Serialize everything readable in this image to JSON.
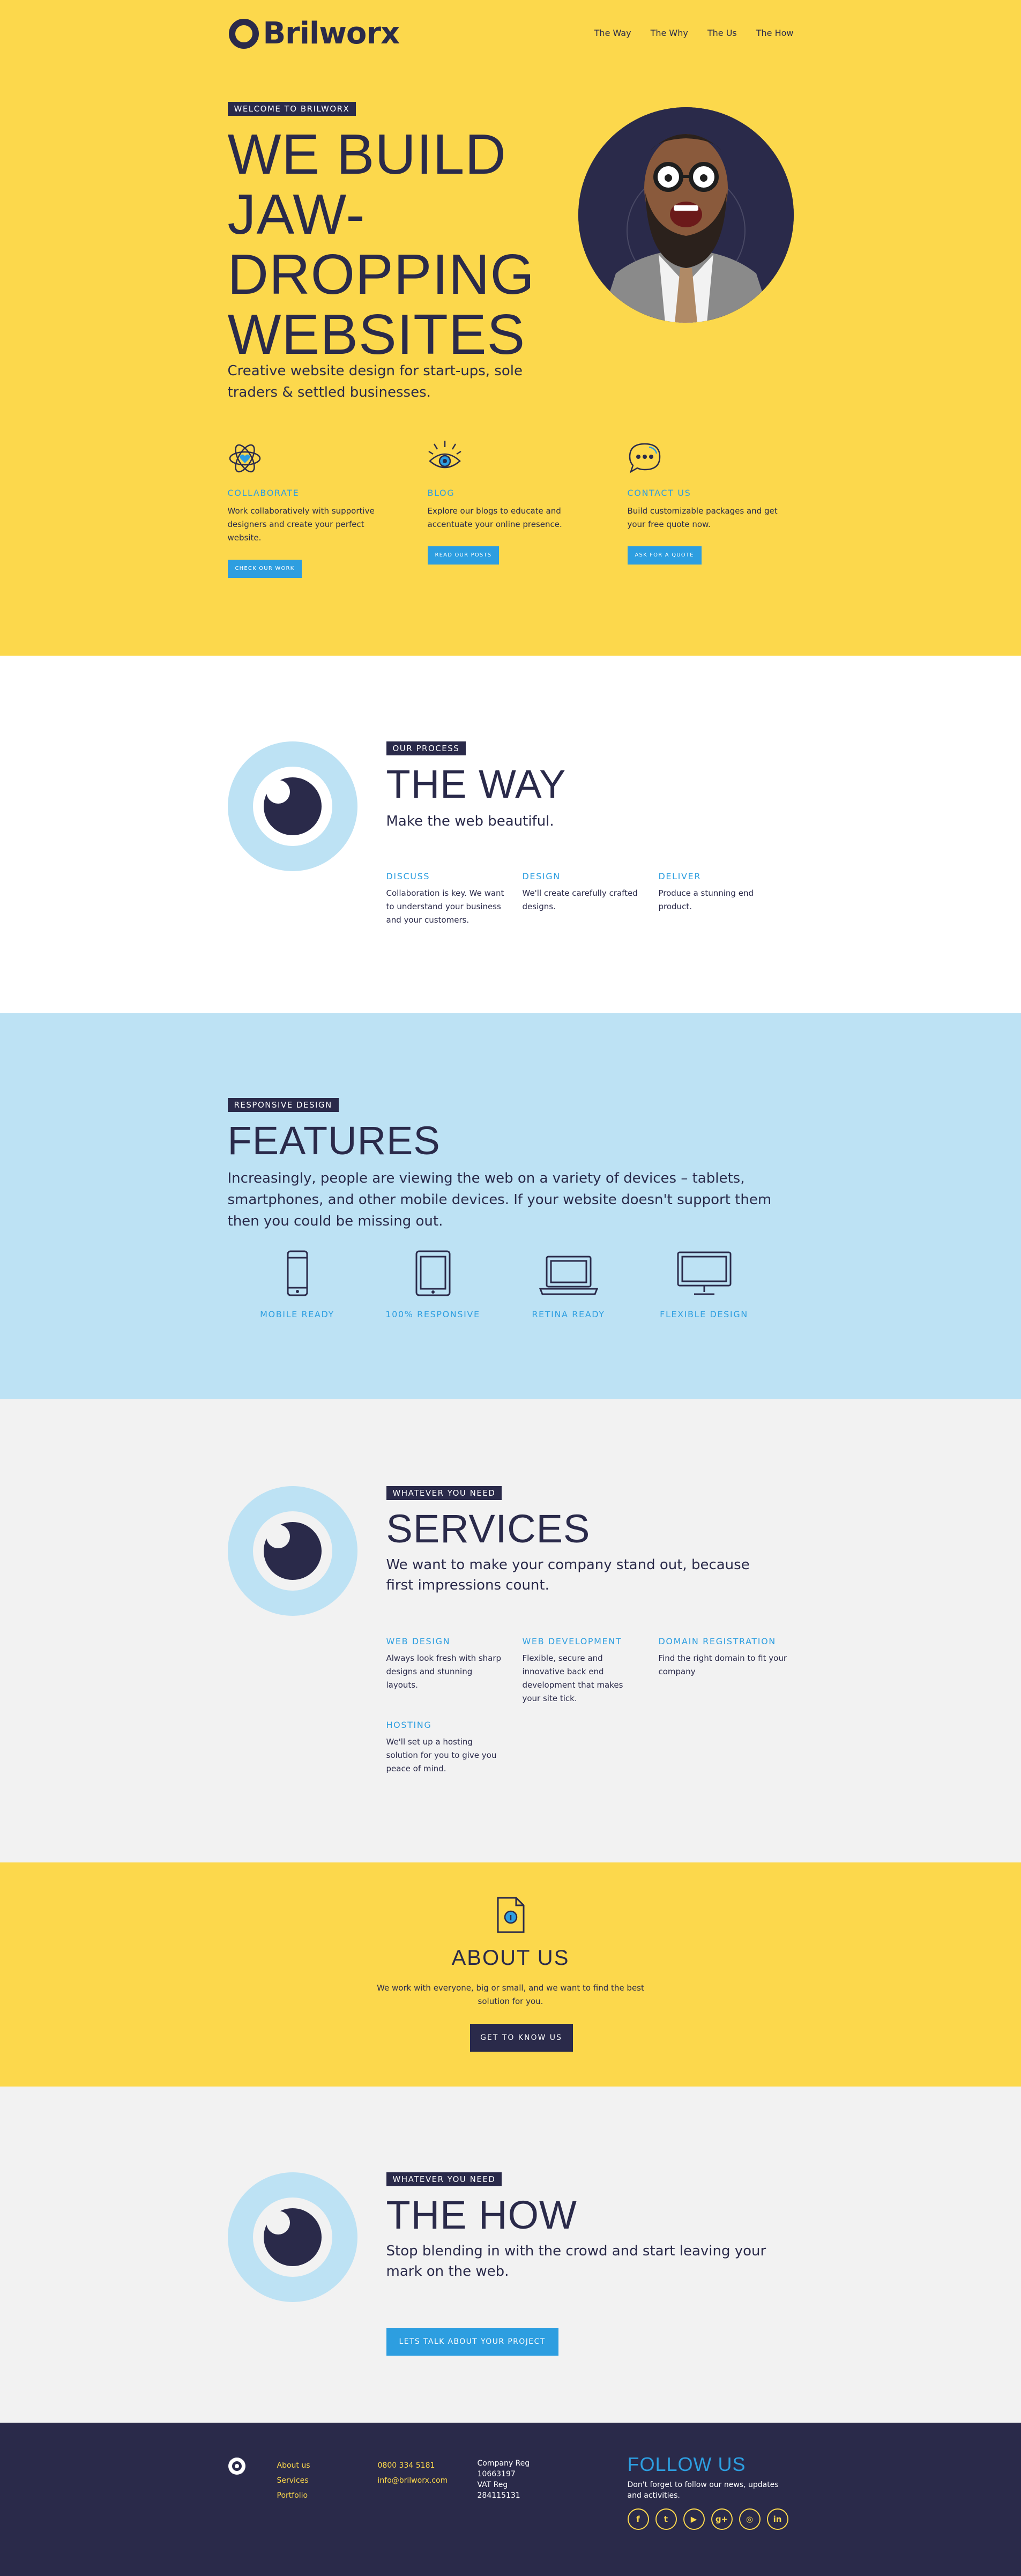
{
  "header": {
    "brand": "Brilworx",
    "nav": [
      "The Way",
      "The Why",
      "The Us",
      "The How"
    ]
  },
  "hero": {
    "tag": "WELCOME TO BRILWORX",
    "title_lines": [
      "WE BUILD",
      "JAW-",
      "DROPPING",
      "WEBSITES"
    ],
    "subtitle": "Creative website design for start-ups, sole traders & settled businesses.",
    "features": [
      {
        "icon": "atom-heart-icon",
        "label": "COLLABORATE",
        "text": "Work collaboratively with supportive designers and create your perfect website.",
        "button": "CHECK OUR WORK"
      },
      {
        "icon": "eye-icon",
        "label": "BLOG",
        "text": "Explore our blogs to educate and accentuate your online presence.",
        "button": "READ OUR POSTS"
      },
      {
        "icon": "chat-bubble-icon",
        "label": "CONTACT US",
        "text": "Build customizable packages and get your free quote now.",
        "button": "ASK FOR A QUOTE"
      }
    ]
  },
  "way": {
    "tag": "OUR PROCESS",
    "title": "THE WAY",
    "lead": "Make the web beautiful.",
    "columns": [
      {
        "label": "DISCUSS",
        "text": "Collaboration is key. We want to understand your business and your customers."
      },
      {
        "label": "DESIGN",
        "text": "We'll create carefully crafted designs."
      },
      {
        "label": "DELIVER",
        "text": "Produce a stunning end product."
      }
    ]
  },
  "features": {
    "tag": "RESPONSIVE DESIGN",
    "title": "FEATURES",
    "lead": "Increasingly, people are viewing the web on a variety of devices – tablets, smartphones, and other mobile devices. If your website doesn't support them then you could be missing out.",
    "items": [
      {
        "icon": "smartphone-icon",
        "label": "MOBILE READY"
      },
      {
        "icon": "tablet-icon",
        "label": "100% RESPONSIVE"
      },
      {
        "icon": "laptop-icon",
        "label": "RETINA READY"
      },
      {
        "icon": "desktop-monitor-icon",
        "label": "FLEXIBLE DESIGN"
      }
    ]
  },
  "services": {
    "tag": "WHATEVER YOU NEED",
    "title": "SERVICES",
    "lead": "We want to make your company stand out, because first impressions count.",
    "columns": [
      {
        "label": "WEB DESIGN",
        "text": "Always look fresh with sharp designs and stunning layouts."
      },
      {
        "label": "WEB DEVELOPMENT",
        "text": "Flexible, secure and innovative back end development that makes your site tick."
      },
      {
        "label": "DOMAIN REGISTRATION",
        "text": "Find the right domain to fit your company"
      },
      {
        "label": "HOSTING",
        "text": "We'll set up a hosting solution for you to give you peace of mind."
      }
    ]
  },
  "about": {
    "icon": "document-icon",
    "title": "ABOUT US",
    "text": "We work with everyone, big or small, and we want to find the best solution for you.",
    "button": "GET TO KNOW US"
  },
  "how": {
    "tag": "WHATEVER YOU NEED",
    "title": "THE HOW",
    "lead": "Stop blending in with the crowd and start leaving your mark on the web.",
    "button": "LETS TALK ABOUT YOUR PROJECT"
  },
  "footer": {
    "links": [
      "About us",
      "Services",
      "Portfolio"
    ],
    "phone": "0800 334 5181",
    "email": "info@brilworx.com",
    "company": [
      "Company Reg",
      "10663197",
      "VAT Reg",
      "284115131"
    ],
    "follow_title": "FOLLOW US",
    "follow_text": "Don't forget to follow our news, updates and activities.",
    "social": [
      {
        "icon": "facebook-icon",
        "glyph": "f"
      },
      {
        "icon": "twitter-icon",
        "glyph": "t"
      },
      {
        "icon": "youtube-icon",
        "glyph": "▶"
      },
      {
        "icon": "google-plus-icon",
        "glyph": "g+"
      },
      {
        "icon": "instagram-icon",
        "glyph": "◎"
      },
      {
        "icon": "linkedin-icon",
        "glyph": "in"
      }
    ]
  },
  "colors": {
    "yellow": "#fcd84c",
    "navy": "#2a2a4a",
    "light_blue": "#bde2f4",
    "accent_blue": "#2d9ee0",
    "grey": "#f2f2f2"
  }
}
